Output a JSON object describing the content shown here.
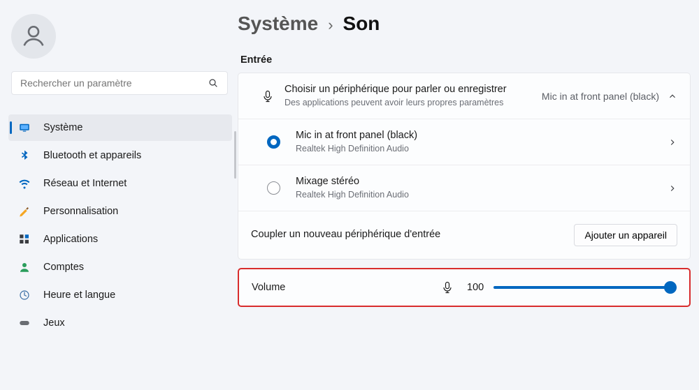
{
  "search": {
    "placeholder": "Rechercher un paramètre"
  },
  "nav": {
    "items": [
      {
        "label": "Système",
        "selected": true
      },
      {
        "label": "Bluetooth et appareils"
      },
      {
        "label": "Réseau et Internet"
      },
      {
        "label": "Personnalisation"
      },
      {
        "label": "Applications"
      },
      {
        "label": "Comptes"
      },
      {
        "label": "Heure et langue"
      },
      {
        "label": "Jeux"
      }
    ]
  },
  "breadcrumb": {
    "parent": "Système",
    "sep": "›",
    "current": "Son"
  },
  "input_section": {
    "title": "Entrée",
    "chooser": {
      "primary": "Choisir un périphérique pour parler ou enregistrer",
      "secondary": "Des applications peuvent avoir leurs propres paramètres",
      "value": "Mic in at front panel (black)"
    },
    "devices": [
      {
        "name": "Mic in at front panel (black)",
        "driver": "Realtek High Definition Audio",
        "selected": true
      },
      {
        "name": "Mixage stéréo",
        "driver": "Realtek High Definition Audio",
        "selected": false
      }
    ],
    "pair": {
      "label": "Coupler un nouveau périphérique d'entrée",
      "button": "Ajouter un appareil"
    }
  },
  "volume": {
    "label": "Volume",
    "value": "100",
    "percent": 100
  }
}
